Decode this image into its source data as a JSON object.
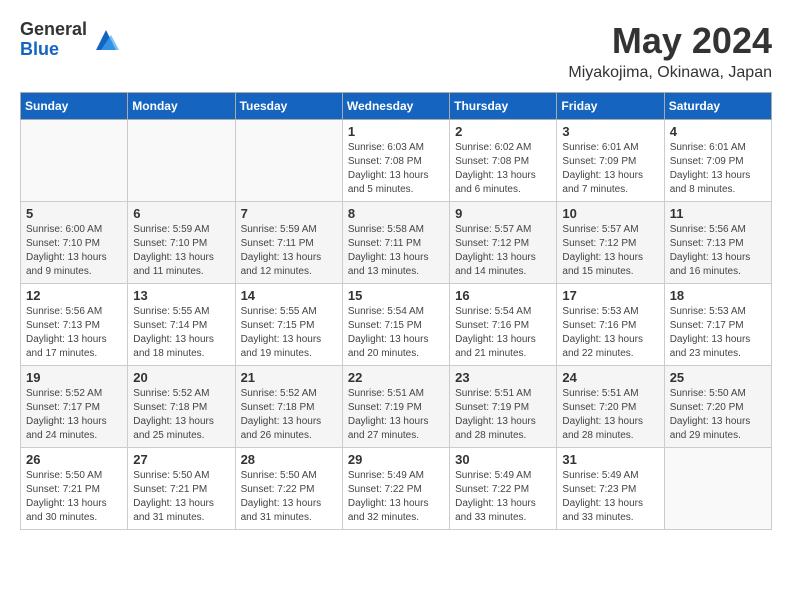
{
  "logo": {
    "general": "General",
    "blue": "Blue"
  },
  "header": {
    "month_year": "May 2024",
    "location": "Miyakojima, Okinawa, Japan"
  },
  "days_of_week": [
    "Sunday",
    "Monday",
    "Tuesday",
    "Wednesday",
    "Thursday",
    "Friday",
    "Saturday"
  ],
  "weeks": [
    [
      {
        "day": "",
        "info": ""
      },
      {
        "day": "",
        "info": ""
      },
      {
        "day": "",
        "info": ""
      },
      {
        "day": "1",
        "info": "Sunrise: 6:03 AM\nSunset: 7:08 PM\nDaylight: 13 hours\nand 5 minutes."
      },
      {
        "day": "2",
        "info": "Sunrise: 6:02 AM\nSunset: 7:08 PM\nDaylight: 13 hours\nand 6 minutes."
      },
      {
        "day": "3",
        "info": "Sunrise: 6:01 AM\nSunset: 7:09 PM\nDaylight: 13 hours\nand 7 minutes."
      },
      {
        "day": "4",
        "info": "Sunrise: 6:01 AM\nSunset: 7:09 PM\nDaylight: 13 hours\nand 8 minutes."
      }
    ],
    [
      {
        "day": "5",
        "info": "Sunrise: 6:00 AM\nSunset: 7:10 PM\nDaylight: 13 hours\nand 9 minutes."
      },
      {
        "day": "6",
        "info": "Sunrise: 5:59 AM\nSunset: 7:10 PM\nDaylight: 13 hours\nand 11 minutes."
      },
      {
        "day": "7",
        "info": "Sunrise: 5:59 AM\nSunset: 7:11 PM\nDaylight: 13 hours\nand 12 minutes."
      },
      {
        "day": "8",
        "info": "Sunrise: 5:58 AM\nSunset: 7:11 PM\nDaylight: 13 hours\nand 13 minutes."
      },
      {
        "day": "9",
        "info": "Sunrise: 5:57 AM\nSunset: 7:12 PM\nDaylight: 13 hours\nand 14 minutes."
      },
      {
        "day": "10",
        "info": "Sunrise: 5:57 AM\nSunset: 7:12 PM\nDaylight: 13 hours\nand 15 minutes."
      },
      {
        "day": "11",
        "info": "Sunrise: 5:56 AM\nSunset: 7:13 PM\nDaylight: 13 hours\nand 16 minutes."
      }
    ],
    [
      {
        "day": "12",
        "info": "Sunrise: 5:56 AM\nSunset: 7:13 PM\nDaylight: 13 hours\nand 17 minutes."
      },
      {
        "day": "13",
        "info": "Sunrise: 5:55 AM\nSunset: 7:14 PM\nDaylight: 13 hours\nand 18 minutes."
      },
      {
        "day": "14",
        "info": "Sunrise: 5:55 AM\nSunset: 7:15 PM\nDaylight: 13 hours\nand 19 minutes."
      },
      {
        "day": "15",
        "info": "Sunrise: 5:54 AM\nSunset: 7:15 PM\nDaylight: 13 hours\nand 20 minutes."
      },
      {
        "day": "16",
        "info": "Sunrise: 5:54 AM\nSunset: 7:16 PM\nDaylight: 13 hours\nand 21 minutes."
      },
      {
        "day": "17",
        "info": "Sunrise: 5:53 AM\nSunset: 7:16 PM\nDaylight: 13 hours\nand 22 minutes."
      },
      {
        "day": "18",
        "info": "Sunrise: 5:53 AM\nSunset: 7:17 PM\nDaylight: 13 hours\nand 23 minutes."
      }
    ],
    [
      {
        "day": "19",
        "info": "Sunrise: 5:52 AM\nSunset: 7:17 PM\nDaylight: 13 hours\nand 24 minutes."
      },
      {
        "day": "20",
        "info": "Sunrise: 5:52 AM\nSunset: 7:18 PM\nDaylight: 13 hours\nand 25 minutes."
      },
      {
        "day": "21",
        "info": "Sunrise: 5:52 AM\nSunset: 7:18 PM\nDaylight: 13 hours\nand 26 minutes."
      },
      {
        "day": "22",
        "info": "Sunrise: 5:51 AM\nSunset: 7:19 PM\nDaylight: 13 hours\nand 27 minutes."
      },
      {
        "day": "23",
        "info": "Sunrise: 5:51 AM\nSunset: 7:19 PM\nDaylight: 13 hours\nand 28 minutes."
      },
      {
        "day": "24",
        "info": "Sunrise: 5:51 AM\nSunset: 7:20 PM\nDaylight: 13 hours\nand 28 minutes."
      },
      {
        "day": "25",
        "info": "Sunrise: 5:50 AM\nSunset: 7:20 PM\nDaylight: 13 hours\nand 29 minutes."
      }
    ],
    [
      {
        "day": "26",
        "info": "Sunrise: 5:50 AM\nSunset: 7:21 PM\nDaylight: 13 hours\nand 30 minutes."
      },
      {
        "day": "27",
        "info": "Sunrise: 5:50 AM\nSunset: 7:21 PM\nDaylight: 13 hours\nand 31 minutes."
      },
      {
        "day": "28",
        "info": "Sunrise: 5:50 AM\nSunset: 7:22 PM\nDaylight: 13 hours\nand 31 minutes."
      },
      {
        "day": "29",
        "info": "Sunrise: 5:49 AM\nSunset: 7:22 PM\nDaylight: 13 hours\nand 32 minutes."
      },
      {
        "day": "30",
        "info": "Sunrise: 5:49 AM\nSunset: 7:22 PM\nDaylight: 13 hours\nand 33 minutes."
      },
      {
        "day": "31",
        "info": "Sunrise: 5:49 AM\nSunset: 7:23 PM\nDaylight: 13 hours\nand 33 minutes."
      },
      {
        "day": "",
        "info": ""
      }
    ]
  ]
}
